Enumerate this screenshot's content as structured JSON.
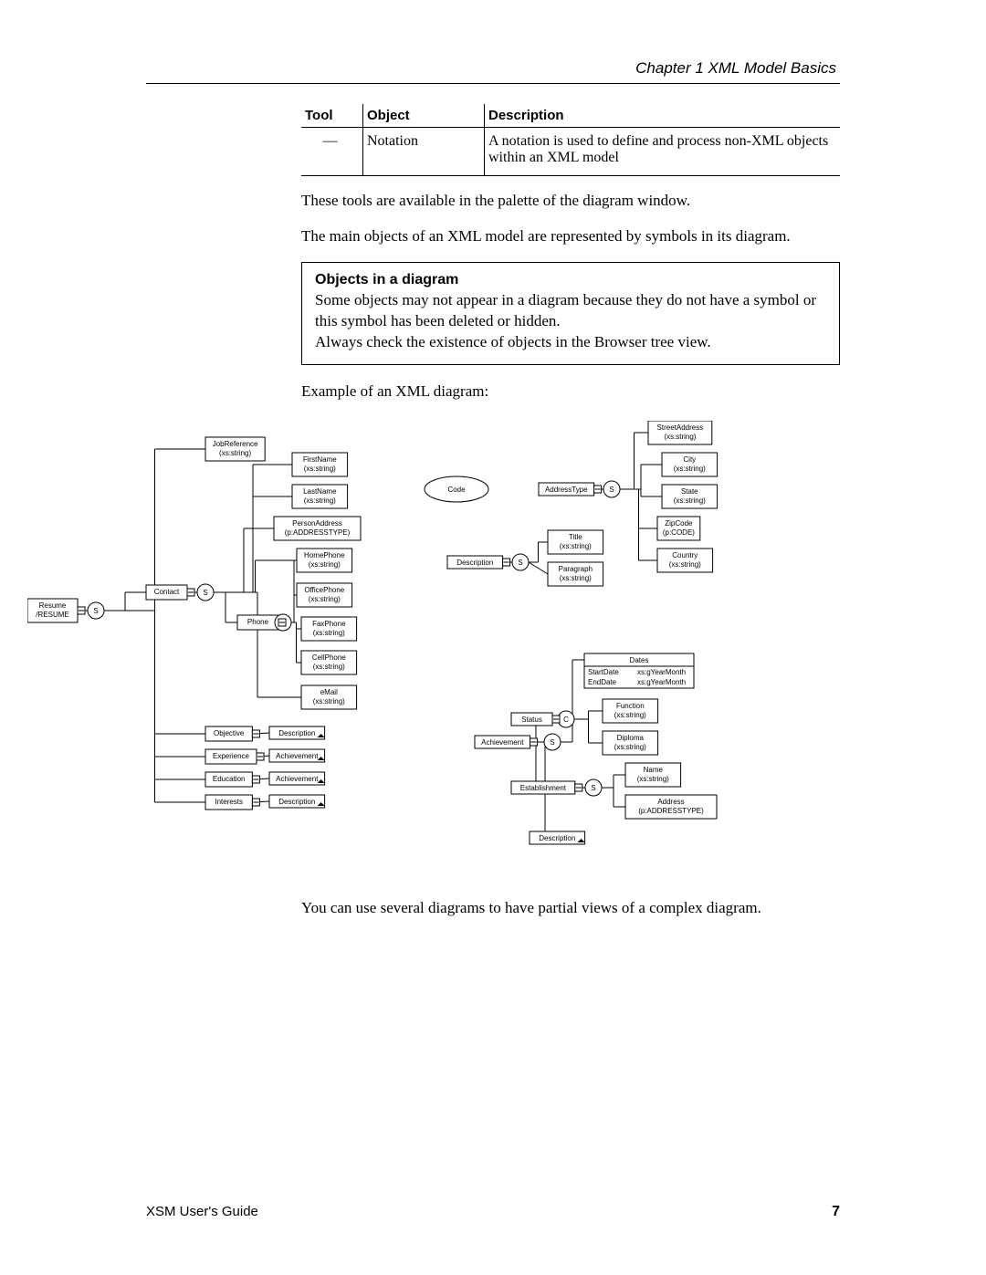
{
  "header": {
    "chapter": "Chapter 1    XML Model Basics"
  },
  "table": {
    "headers": {
      "tool": "Tool",
      "object": "Object",
      "description": "Description"
    },
    "row": {
      "tool": "—",
      "object": "Notation",
      "description": "A notation is used to define and process non-XML objects within an XML model"
    }
  },
  "paragraphs": {
    "p1": "These tools are available in the palette of the diagram window.",
    "p2": "The main objects of an XML model are represented by symbols in its diagram.",
    "caption": "Example of an XML diagram:",
    "p3": "You can use several diagrams to have partial views of a complex diagram."
  },
  "info": {
    "title": "Objects in a diagram",
    "body1": "Some objects may not appear in a diagram because they do not have a symbol or this symbol has been deleted or hidden.",
    "body2": "Always check the existence of objects in the Browser tree view."
  },
  "diagram": {
    "nodes": {
      "resume": "Resume\n/RESUME",
      "jobref": "JobReference\n(xs:string)",
      "firstname": "FirstName\n(xs:string)",
      "lastname": "LastName\n(xs:string)",
      "personaddress": "PersonAddress\n(p:ADDRESSTYPE)",
      "homephone": "HomePhone\n(xs:string)",
      "officephone": "OfficePhone\n(xs:string)",
      "faxphone": "FaxPhone\n(xs:string)",
      "cellphone": "CellPhone\n(xs:string)",
      "email": "eMail\n(xs:string)",
      "contact": "Contact",
      "phone": "Phone",
      "objective": "Objective",
      "experience": "Experience",
      "education": "Education",
      "interests": "Interests",
      "descref1": "Description",
      "achref1": "Achievement",
      "achref2": "Achievement",
      "descref2": "Description",
      "code": "Code",
      "description": "Description",
      "title": "Title\n(xs:string)",
      "paragraph": "Paragraph\n(xs:string)",
      "addresstype": "AddressType",
      "streetaddress": "StreetAddress\n(xs:string)",
      "city": "City\n(xs:string)",
      "state": "State\n(xs:string)",
      "zipcode": "ZipCode\n(p:CODE)",
      "country": "Country\n(xs:string)",
      "achievement": "Achievement",
      "dates": "Dates",
      "startdate": "StartDate",
      "enddate": "EndDate",
      "gyearmonth": "xs:gYearMonth",
      "status": "Status",
      "function": "Function\n(xs:string)",
      "diploma": "Diploma\n(xs:string)",
      "establishment": "Establishment",
      "name": "Name\n(xs:string)",
      "address": "Address\n(p:ADDRESSTYPE)",
      "descref3": "Description"
    }
  },
  "footer": {
    "guide": "XSM User's Guide",
    "page": "7"
  }
}
